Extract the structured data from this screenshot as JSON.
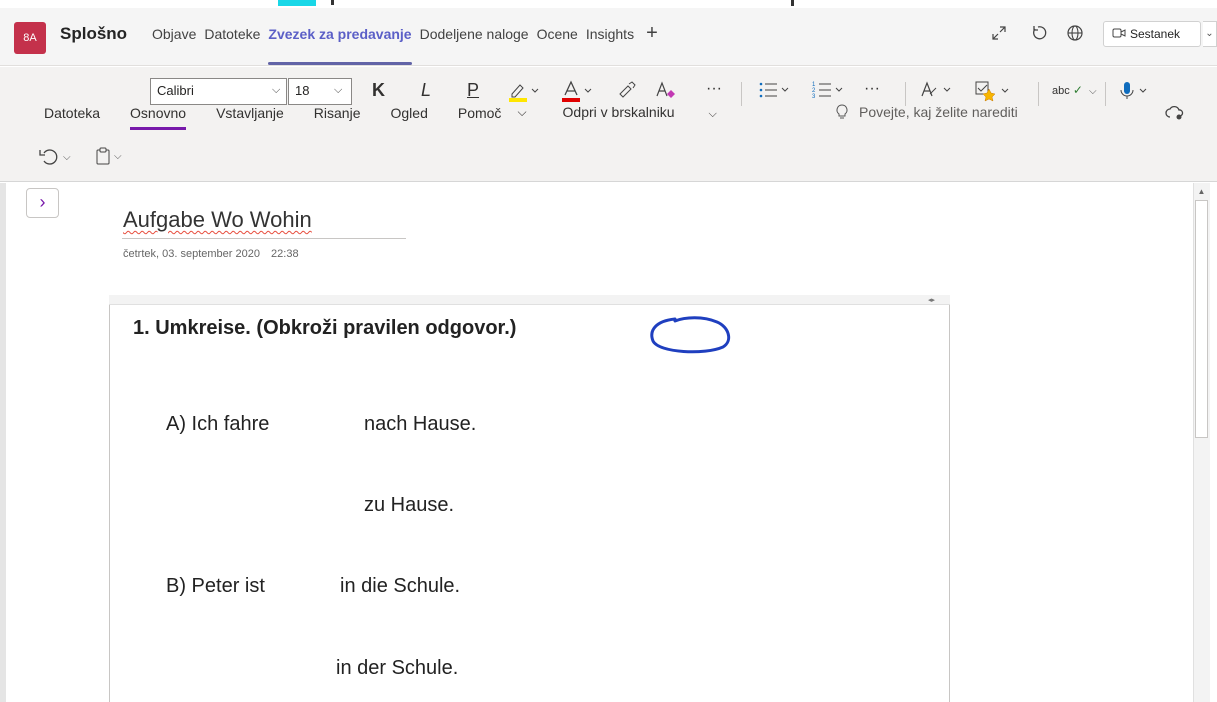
{
  "teams": {
    "avatar": "8A",
    "channel": "Splošno",
    "tabs": [
      "Objave",
      "Datoteke",
      "Zvezek za predavanje",
      "Dodeljene naloge",
      "Ocene",
      "Insights"
    ],
    "active_tab": "Zvezek za predavanje",
    "add_tab": "+",
    "meet_label": "Sestanek"
  },
  "ribbon": {
    "menu": [
      "Datoteka",
      "Osnovno",
      "Vstavljanje",
      "Risanje",
      "Ogled",
      "Pomoč"
    ],
    "active_menu": "Osnovno",
    "open_browser": "Odpri v brskalniku",
    "tell_me": "Povejte, kaj želite narediti",
    "font": "Calibri",
    "font_size": "18",
    "bold": "K",
    "italic": "L",
    "underline": "P",
    "more": "···",
    "spell": "abc"
  },
  "page": {
    "title": "Aufgabe Wo Wohin",
    "date": "četrtek, 03. september 2020",
    "time": "22:38"
  },
  "note": {
    "question": "1. Umkreise. (Obkroži pravilen odgovor.)",
    "a_label": "A) Ich fahre",
    "a_opt1": "nach Hause.",
    "a_opt2": "zu Hause.",
    "b_label": "B) Peter ist",
    "b_opt1": "in die Schule.",
    "b_opt2": "in der Schule."
  },
  "colors": {
    "accent": "#6264a7",
    "onenote": "#7719aa",
    "avatar": "#c4314b",
    "ink": "#1f3fbf",
    "highlight": "#ffe600",
    "font_color": "#e00000"
  }
}
